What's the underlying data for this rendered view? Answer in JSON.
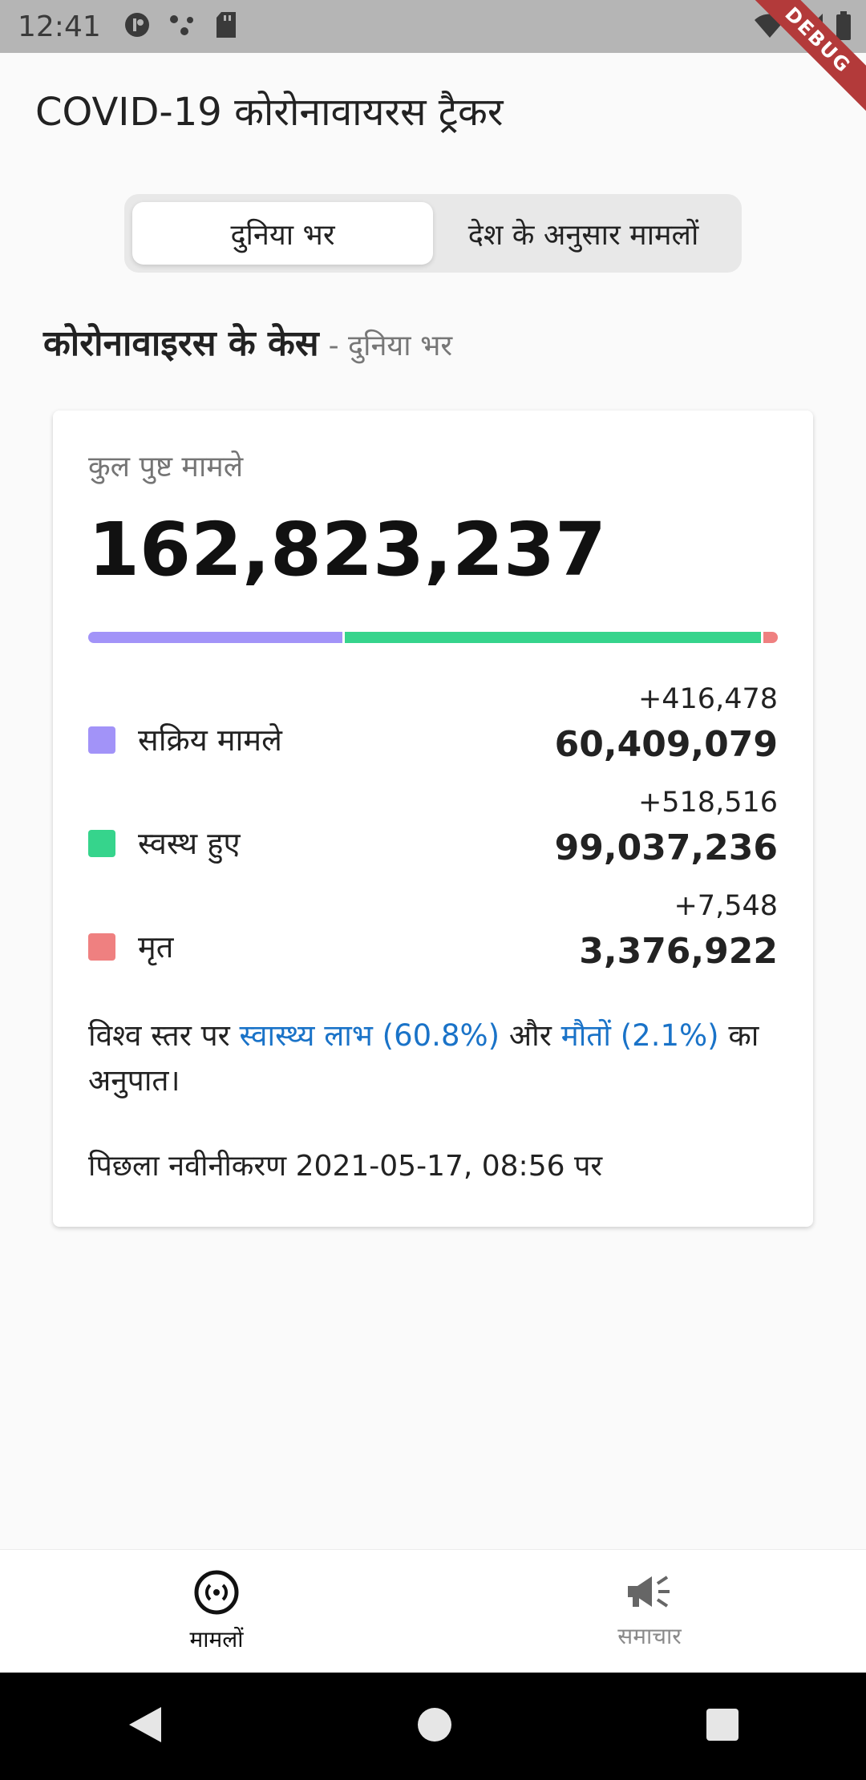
{
  "status_bar": {
    "time": "12:41"
  },
  "debug_ribbon": "DEBUG",
  "app": {
    "title": "COVID-19 कोरोनावायरस ट्रैकर"
  },
  "tabs": [
    {
      "label": "दुनिया भर",
      "active": true
    },
    {
      "label": "देश के अनुसार मामलों",
      "active": false
    }
  ],
  "section": {
    "title": "कोरोनावाइरस के केस",
    "subtitle": "- दुनिया भर"
  },
  "card": {
    "total_label": "कुल पुष्ट मामले",
    "total_value": "162,823,237",
    "bar_fractions": {
      "active": 0.371,
      "recovered": 0.608,
      "deaths": 0.021
    },
    "stats": [
      {
        "label": "सक्रिय मामले",
        "delta": "+416,478",
        "value": "60,409,079",
        "color": "#a293f8"
      },
      {
        "label": "स्वस्थ हुए",
        "delta": "+518,516",
        "value": "99,037,236",
        "color": "#36d48c"
      },
      {
        "label": "मृत",
        "delta": "+7,548",
        "value": "3,376,922",
        "color": "#ef8080"
      }
    ],
    "ratio": {
      "prefix": "विश्व स्तर पर ",
      "recovery_link": "स्वास्थ्य लाभ (60.8%)",
      "middle": " और ",
      "death_link": "मौतों (2.1%)",
      "suffix": " का अनुपात।"
    },
    "last_updated": "पिछला नवीनीकरण 2021-05-17, 08:56 पर"
  },
  "bottom_nav": [
    {
      "label": "मामलों",
      "icon": "cases-icon",
      "active": true
    },
    {
      "label": "समाचार",
      "icon": "megaphone-icon",
      "active": false
    }
  ],
  "colors": {
    "link": "#1a73c8",
    "active": "#a293f8",
    "recovered": "#36d48c",
    "deaths": "#ef8080"
  }
}
